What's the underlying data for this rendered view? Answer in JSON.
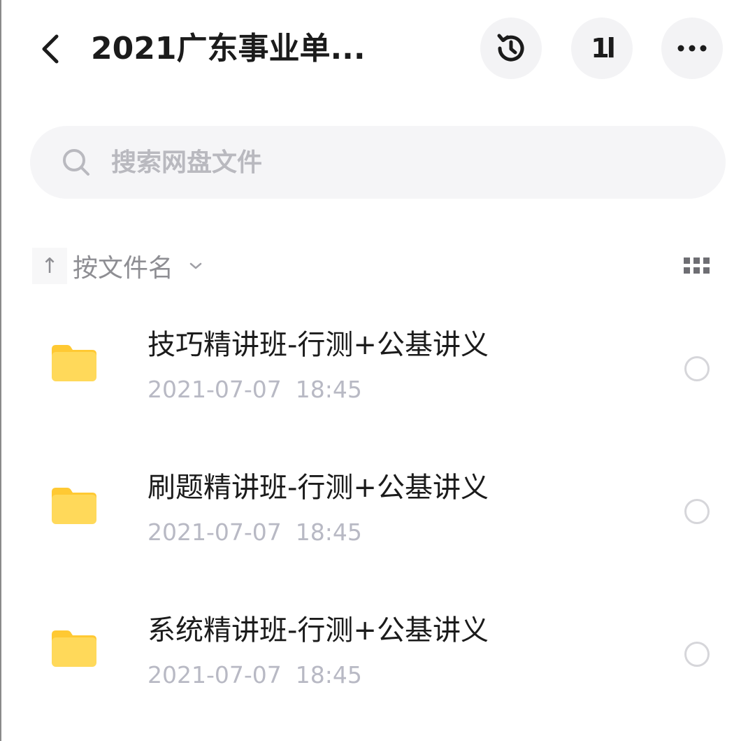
{
  "header": {
    "title": "2021广东事业单...",
    "back_icon": "chevron-left-icon",
    "history_icon": "history-icon",
    "sort_icon": "sort-order-icon",
    "sort_glyph": "1l",
    "more_icon": "more-horizontal-icon"
  },
  "search": {
    "placeholder": "搜索网盘文件",
    "value": ""
  },
  "sort": {
    "direction_glyph": "↑",
    "label": "按文件名"
  },
  "files": [
    {
      "name": "技巧精讲班-行测+公基讲义",
      "date": "2021-07-07",
      "time": "18:45"
    },
    {
      "name": "刷题精讲班-行测+公基讲义",
      "date": "2021-07-07",
      "time": "18:45"
    },
    {
      "name": "系统精讲班-行测+公基讲义",
      "date": "2021-07-07",
      "time": "18:45"
    }
  ],
  "colors": {
    "folder": "#FFD95A",
    "folder_tab": "#FFC933",
    "button_bg": "#F3F3F5",
    "muted_text": "#8E8E93",
    "meta_text": "#B8B9C4"
  }
}
